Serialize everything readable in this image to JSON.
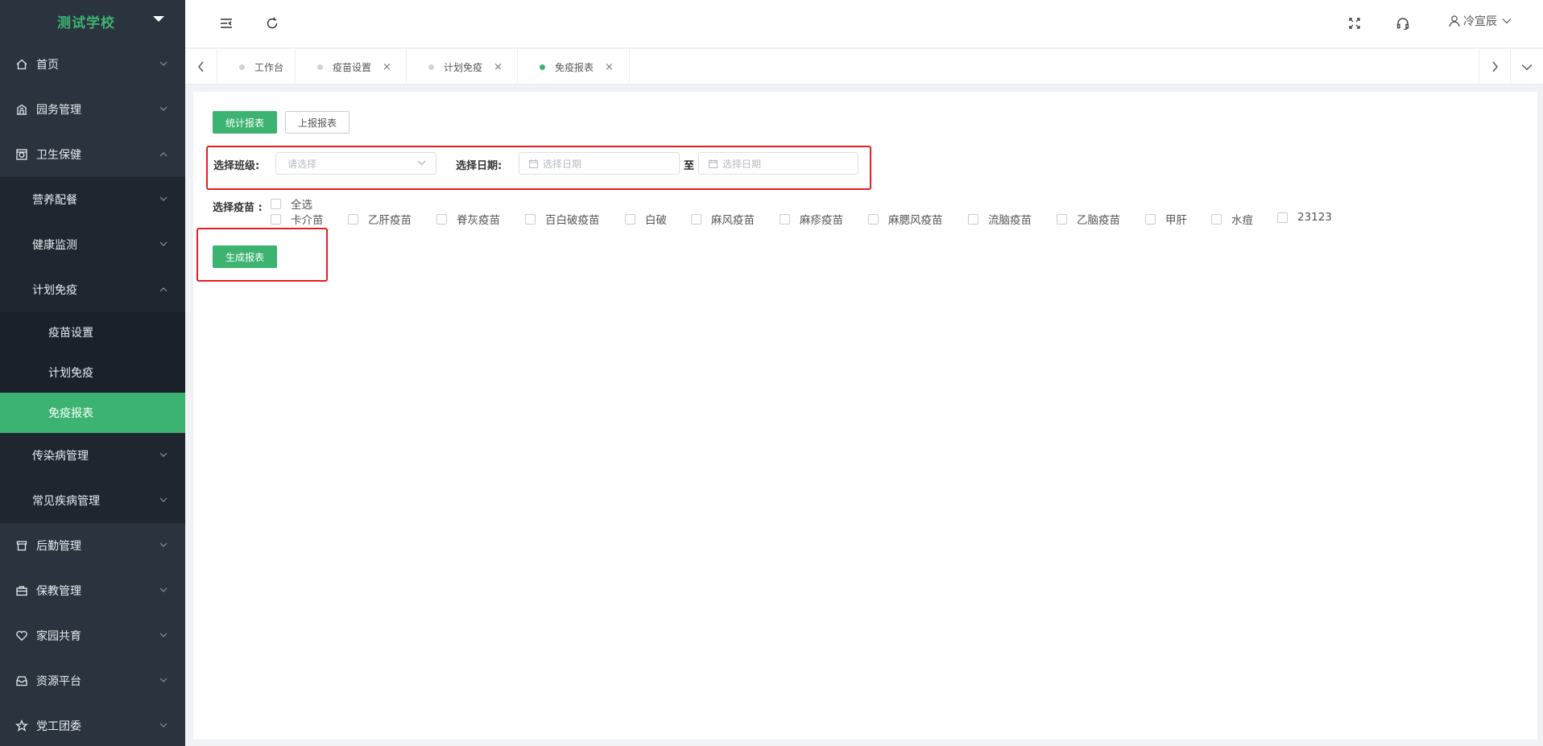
{
  "brand": {
    "name": "测试学校"
  },
  "sidebar": {
    "top_items": [
      {
        "label": "首页",
        "icon": "home-icon"
      },
      {
        "label": "园务管理",
        "icon": "building-icon"
      },
      {
        "label": "卫生保健",
        "icon": "safe-icon"
      }
    ],
    "health_sub": [
      {
        "label": "营养配餐"
      },
      {
        "label": "健康监测"
      },
      {
        "label": "计划免疫"
      }
    ],
    "immunization_leaves": [
      {
        "label": "疫苗设置"
      },
      {
        "label": "计划免疫"
      },
      {
        "label": "免疫报表"
      }
    ],
    "health_sub_after": [
      {
        "label": "传染病管理"
      },
      {
        "label": "常见疾病管理"
      }
    ],
    "bottom_items": [
      {
        "label": "后勤管理",
        "icon": "store-icon"
      },
      {
        "label": "保教管理",
        "icon": "briefcase-icon"
      },
      {
        "label": "家园共育",
        "icon": "heart-icon"
      },
      {
        "label": "资源平台",
        "icon": "inbox-icon"
      },
      {
        "label": "党工团委",
        "icon": "star-icon"
      }
    ]
  },
  "header": {
    "user_name": "冷宣辰"
  },
  "tabs": [
    {
      "label": "工作台",
      "closable": false
    },
    {
      "label": "疫苗设置",
      "closable": true
    },
    {
      "label": "计划免疫",
      "closable": true
    },
    {
      "label": "免疫报表",
      "closable": true,
      "active": true
    }
  ],
  "tab_close_glyph": "×",
  "report": {
    "btn_stats": "统计报表",
    "btn_upload": "上报报表",
    "class_label": "选择班级:",
    "class_placeholder": "请选择",
    "date_label": "选择日期:",
    "date_start_placeholder": "选择日期",
    "date_end_placeholder": "选择日期",
    "date_separator": "至",
    "vaccine_label": "选择疫苗 :",
    "select_all": "全选",
    "vaccines": [
      "卡介苗",
      "乙肝疫苗",
      "脊灰疫苗",
      "百白破疫苗",
      "白破",
      "麻风疫苗",
      "麻疹疫苗",
      "麻腮风疫苗",
      "流脑疫苗",
      "乙脑疫苗",
      "甲肝",
      "水痘",
      "23123"
    ],
    "btn_generate": "生成报表"
  },
  "colors": {
    "accent": "#3cb371",
    "sidebar_bg": "#2b333e",
    "highlight": "#e41f1f"
  }
}
